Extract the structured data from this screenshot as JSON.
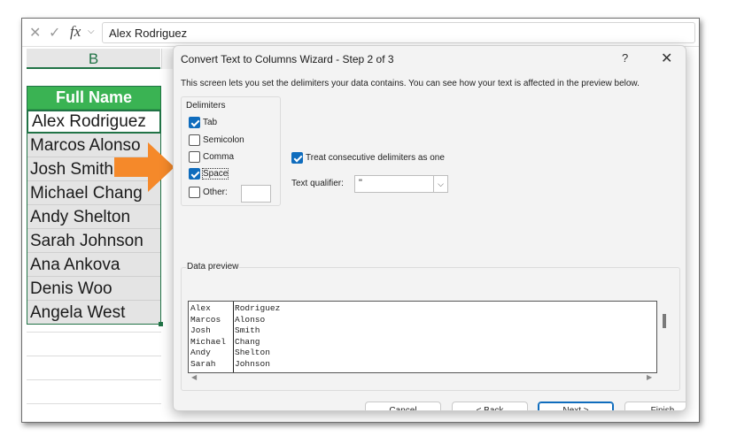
{
  "formula_bar": {
    "value": "Alex Rodriguez",
    "fx_label": "fx"
  },
  "sheet": {
    "column_letter": "B",
    "header_cell": "Full Name",
    "rows": [
      "Alex Rodriguez",
      "Marcos Alonso",
      "Josh Smith",
      "Michael Chang",
      "Andy Shelton",
      "Sarah Johnson",
      "Ana Ankova",
      "Denis Woo",
      "Angela West"
    ]
  },
  "dialog": {
    "title": "Convert Text to Columns Wizard - Step 2 of 3",
    "help_label": "?",
    "close_label": "✕",
    "description": "This screen lets you set the delimiters your data contains.  You can see how your text is affected in the preview below.",
    "delimiters_label": "Delimiters",
    "delimiters": [
      {
        "label": "Tab",
        "checked": true
      },
      {
        "label": "Semicolon",
        "checked": false
      },
      {
        "label": "Comma",
        "checked": false
      },
      {
        "label": "Space",
        "checked": true
      },
      {
        "label": "Other:",
        "checked": false
      }
    ],
    "treat_consecutive": {
      "label": "Treat consecutive delimiters as one",
      "checked": true
    },
    "text_qualifier": {
      "label": "Text qualifier:",
      "value": "\""
    },
    "data_preview_label": "Data preview",
    "preview": {
      "col1": [
        "Alex",
        "Marcos",
        "Josh",
        "Michael",
        "Andy",
        "Sarah"
      ],
      "col2": [
        "Rodriguez",
        "Alonso",
        "Smith",
        "Chang",
        "Shelton",
        "Johnson"
      ]
    },
    "buttons": {
      "cancel": "Cancel",
      "back": "< Back",
      "next": "Next >",
      "finish": "Finish"
    }
  },
  "colors": {
    "accent_green": "#217346",
    "header_green": "#3ab353",
    "arrow_orange": "#f5892a",
    "checkbox_blue": "#0f6cbd"
  }
}
